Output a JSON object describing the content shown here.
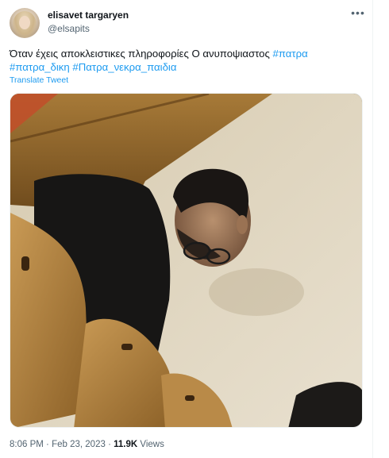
{
  "tweet": {
    "display_name": "elisavet targaryen",
    "handle": "@elsapits",
    "text_plain": "Όταν έχεις αποκλειστικες πληροφορίες Ο ανυποψιαστος ",
    "hashtags": [
      "#πατρα",
      "#πατρα_δικη",
      "#Πατρα_νεκρα_παιδια"
    ],
    "translate_label": "Translate Tweet",
    "time": "8:06 PM",
    "date": "Feb 23, 2023",
    "separator": "·",
    "views_count": "11.9K",
    "views_label": "Views"
  },
  "icons": {
    "more": "more-horizontal-icon",
    "avatar": "user-avatar"
  },
  "colors": {
    "link": "#1d9bf0",
    "text": "#0f1419",
    "muted": "#536471"
  }
}
